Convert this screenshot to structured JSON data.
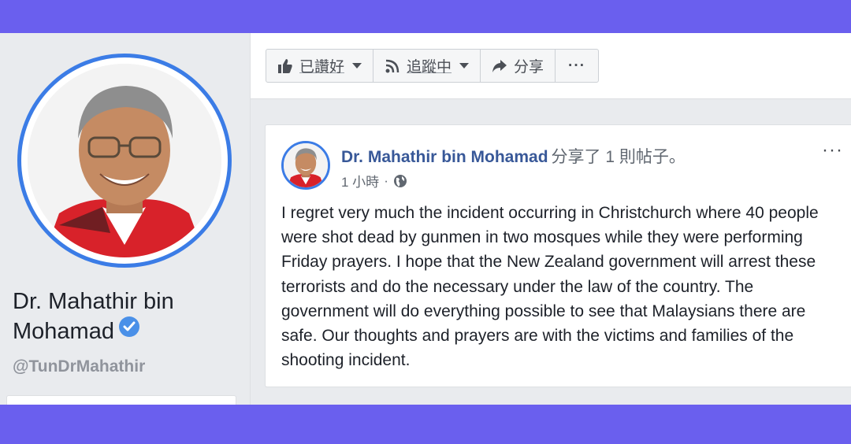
{
  "profile": {
    "name": "Dr. Mahathir bin Mohamad",
    "handle": "@TunDrMahathir"
  },
  "actions": {
    "like_label": "已讚好",
    "follow_label": "追蹤中",
    "share_label": "分享",
    "more_label": "···"
  },
  "post": {
    "author": "Dr. Mahathir bin Mohamad",
    "shared_text": "分享了 1 則帖子。",
    "time": "1 小時",
    "separator": "·",
    "more_label": "···",
    "body": "I regret very much the incident occurring in Christchurch where 40 people were shot dead by gunmen in two mosques while they were performing Friday prayers. I hope that the New Zealand government will arrest these terrorists and do the necessary under the law of the country. The government will do everything possible to see that Malaysians there are safe. Our thoughts and prayers are with the victims and families of the shooting incident."
  },
  "colors": {
    "frame": "#6a5fee",
    "accent": "#3b7ce6",
    "link": "#385898",
    "verified": "#4a90e8"
  },
  "icons": [
    "like-thumb-icon",
    "rss-follow-icon",
    "share-arrow-icon",
    "more-dots-icon",
    "verified-badge-icon",
    "globe-icon"
  ]
}
